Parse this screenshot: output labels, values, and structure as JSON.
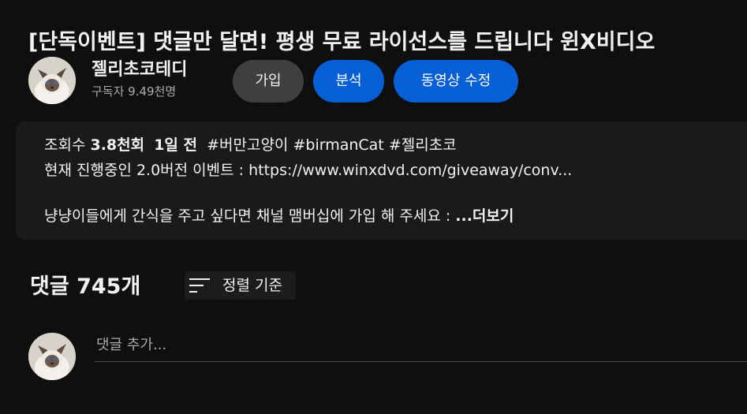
{
  "video": {
    "title": "[단독이벤트] 댓글만 달면! 평생 무료 라이선스를 드립니다 윈X비디오"
  },
  "channel": {
    "name": "젤리초코테디",
    "subscribers": "구독자 9.49천명"
  },
  "actions": {
    "join_label": "가입",
    "analytics_label": "분석",
    "edit_label": "동영상 수정"
  },
  "description": {
    "views_prefix": "조회수 ",
    "views_value": "3.8천회",
    "age_value": "1일 전",
    "hashtags": [
      "#버만고양이",
      "#birmanCat",
      "#젤리초코"
    ],
    "line2": "현재 진행중인 2.0버전 이벤트 : https://www.winxdvd.com/giveaway/conv...",
    "line3": "냥냥이들에게 간식을 주고 싶다면 채널 맴버십에 가입 해 주세요 : ",
    "more_label": "...더보기"
  },
  "comments": {
    "count_label": "댓글 745개",
    "sort_label": "정렬 기준",
    "placeholder": "댓글 추가..."
  },
  "icons": {
    "sort": "sort-icon",
    "avatar": "cat-avatar"
  },
  "colors": {
    "background": "#0f0f0f",
    "accent_blue": "#065fd4",
    "button_gray": "#3f3f3f",
    "secondary_text": "#aaaaaa"
  }
}
